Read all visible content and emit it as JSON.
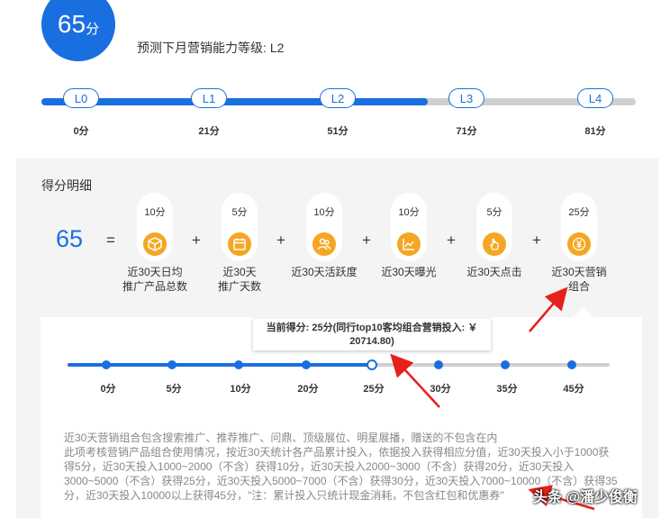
{
  "header": {
    "score_number": "65",
    "score_unit": "分",
    "predict_text": "预测下月营销能力等级:",
    "predict_level": "L2"
  },
  "levels": [
    {
      "label": "L0",
      "score": "0分"
    },
    {
      "label": "L1",
      "score": "21分"
    },
    {
      "label": "L2",
      "score": "51分"
    },
    {
      "label": "L3",
      "score": "71分"
    },
    {
      "label": "L4",
      "score": "81分"
    }
  ],
  "current_level_index": 2,
  "detail": {
    "title": "得分明细",
    "total": "65",
    "equals": "=",
    "plus": "+",
    "factors": [
      {
        "points": "10分",
        "label_line1": "近30天日均",
        "label_line2": "推广产品总数",
        "icon": "box-icon"
      },
      {
        "points": "5分",
        "label_line1": "近30天",
        "label_line2": "推广天数",
        "icon": "calendar-icon"
      },
      {
        "points": "10分",
        "label_line1": "近30天活跃度",
        "label_line2": "",
        "icon": "users-icon"
      },
      {
        "points": "10分",
        "label_line1": "近30天曝光",
        "label_line2": "",
        "icon": "chart-icon"
      },
      {
        "points": "5分",
        "label_line1": "近30天点击",
        "label_line2": "",
        "icon": "hand-click-icon"
      },
      {
        "points": "25分",
        "label_line1": "近30天营销",
        "label_line2": "组合",
        "icon": "yen-icon"
      }
    ]
  },
  "combo": {
    "tooltip_line1": "当前得分: 25分(同行top10客均组合营销投入: ￥",
    "tooltip_line2": "20714.80)",
    "steps": [
      "0分",
      "5分",
      "10分",
      "20分",
      "25分",
      "30分",
      "35分",
      "45分"
    ],
    "current_step_index": 4,
    "desc": "近30天营销组合包含搜索推广、推荐推广、问鼎、顶级展位、明星展播，赠送的不包含在内\n此项考核营销产品组合使用情况，按近30天统计各产品累计投入，依据投入获得相应分值，近30天投入小于1000获得5分，近30天投入1000~2000（不含）获得10分，近30天投入2000~3000（不含）获得20分，近30天投入3000~5000（不含）获得25分，近30天投入5000~7000（不含）获得30分，近30天投入7000~10000（不含）获得35分，近30天投入10000以上获得45分，\"注：累计投入只统计现金消耗，不包含红包和优惠券\""
  },
  "watermark": "头条 @潘少俊衡",
  "colors": {
    "accent": "#1a6fe0",
    "icon": "#f5a623",
    "arrow": "#e8201a"
  }
}
